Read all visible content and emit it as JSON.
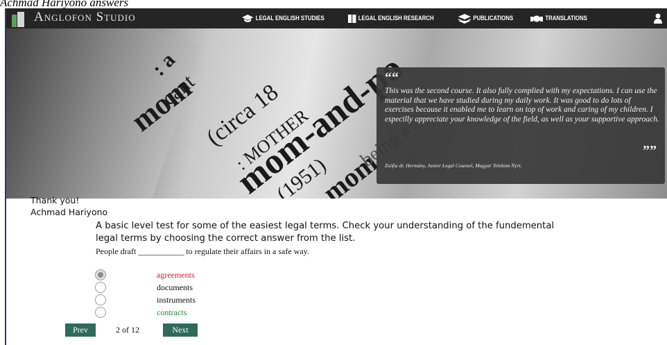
{
  "page": {
    "caption": "Achmad Hariyono answers"
  },
  "header": {
    "logo_text": "Anglofon Studio",
    "nav": [
      {
        "label": "LEGAL ENGLISH STUDIES",
        "icon": "graduation-cap-icon"
      },
      {
        "label": "LEGAL ENGLISH RESEARCH",
        "icon": "book-icon"
      },
      {
        "label": "PUBLICATIONS",
        "icon": "layers-icon"
      },
      {
        "label": "TRANSLATIONS",
        "icon": "handshake-icon"
      }
    ],
    "user_icon": "user-icon"
  },
  "hero": {
    "quote": "This was the second course. It also fully complied with my expectations. I can use the material that we have studied during my daily work. It was good to do lots of exercises because it enabled me to learn on top of work and caring of my children. I especilly appreciate your knowledge of the field, as well as your supportive approach.",
    "open_mark": "““",
    "close_mark": "””",
    "author": "Zsófia dr. Hermány, Junior Legal Counsel, Magyar Telekom Nyrt."
  },
  "content": {
    "thanks": "Thank you!",
    "name": "Achmad Hariyono",
    "intro": "A basic level test for some of the easiest legal terms. Check your understanding of the fundemental legal terms by choosing the correct answer from the list.",
    "question": "People draft ___________ to regulate their affairs in a safe way.",
    "options": [
      {
        "label": "agreements",
        "color": "#cc2222",
        "selected": true
      },
      {
        "label": "documents",
        "color": "#111111",
        "selected": false
      },
      {
        "label": "instruments",
        "color": "#111111",
        "selected": false
      },
      {
        "label": "contracts",
        "color": "#1f8a2a",
        "selected": false
      }
    ]
  },
  "pager": {
    "prev": "Prev",
    "count": "2 of 12",
    "next": "Next"
  },
  "colors": {
    "topbar": "#252525",
    "logo_green": "#5aa25a",
    "button": "#2f6a5a",
    "wrong": "#cc2222",
    "correct": "#1f8a2a"
  }
}
